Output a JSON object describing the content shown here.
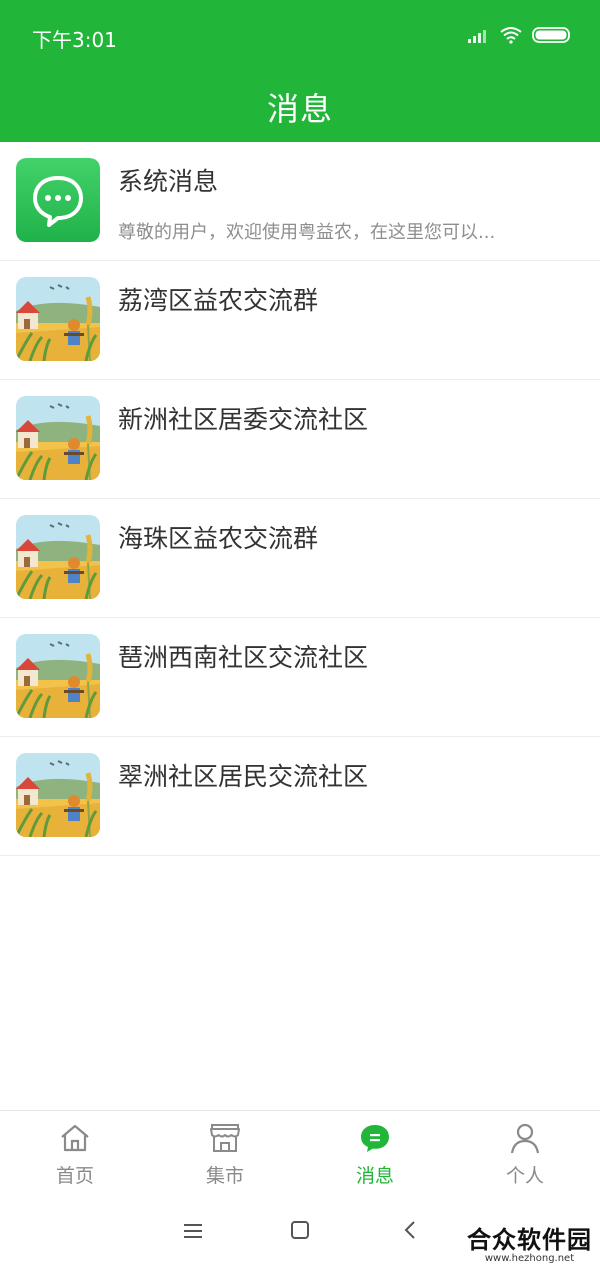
{
  "status_bar": {
    "time": "下午3:01"
  },
  "header": {
    "title": "消息"
  },
  "messages": [
    {
      "title": "系统消息",
      "subtitle": "尊敬的用户，欢迎使用粤益农，在这里您可以...",
      "avatar": "chat-bubble-icon"
    },
    {
      "title": "荔湾区益农交流群",
      "subtitle": "",
      "avatar": "farm-scene-image"
    },
    {
      "title": "新洲社区居委交流社区",
      "subtitle": "",
      "avatar": "farm-scene-image"
    },
    {
      "title": "海珠区益农交流群",
      "subtitle": "",
      "avatar": "farm-scene-image"
    },
    {
      "title": "琶洲西南社区交流社区",
      "subtitle": "",
      "avatar": "farm-scene-image"
    },
    {
      "title": "翠洲社区居民交流社区",
      "subtitle": "",
      "avatar": "farm-scene-image"
    }
  ],
  "tabs": [
    {
      "label": "首页",
      "icon": "home-icon",
      "active": false
    },
    {
      "label": "集市",
      "icon": "store-icon",
      "active": false
    },
    {
      "label": "消息",
      "icon": "message-icon",
      "active": true
    },
    {
      "label": "个人",
      "icon": "person-icon",
      "active": false
    }
  ],
  "watermark": {
    "main": "合众软件园",
    "sub": "www.hezhong.net"
  },
  "colors": {
    "brand": "#21b63a",
    "inactive": "#8a8a8a"
  }
}
